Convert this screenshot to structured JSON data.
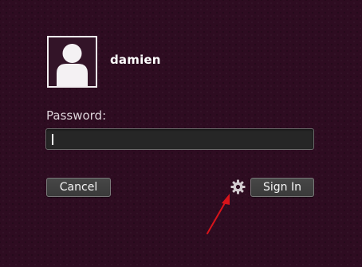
{
  "user": {
    "name": "damien",
    "avatar_icon": "user-silhouette-icon"
  },
  "password": {
    "label": "Password:",
    "value": ""
  },
  "actions": {
    "cancel_label": "Cancel",
    "signin_label": "Sign In",
    "session_icon": "gear-icon"
  },
  "annotation": {
    "arrow_color": "#d8141b"
  },
  "colors": {
    "background": "#2e0c21",
    "text": "#ffffff"
  }
}
